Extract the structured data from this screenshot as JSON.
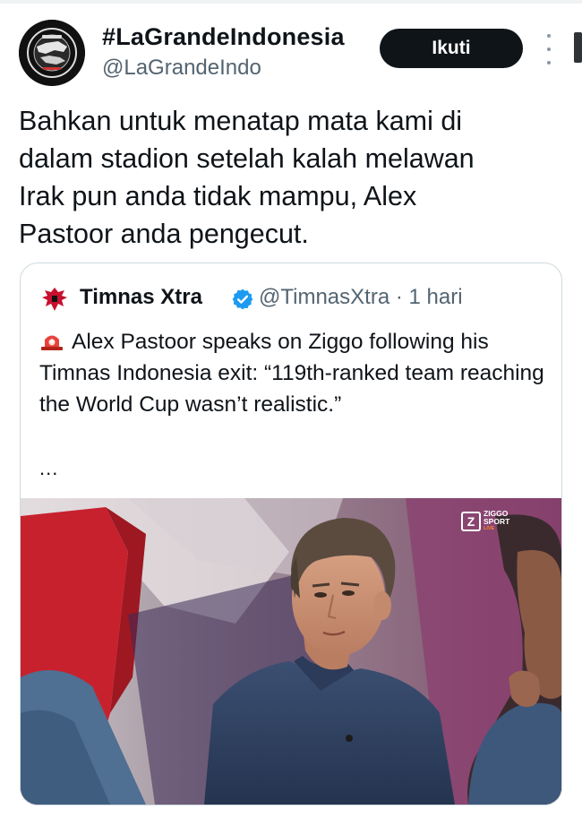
{
  "tweet": {
    "display_name": "#LaGrandeIndonesia",
    "handle": "@LaGrandeIndo",
    "follow_label": "Ikuti",
    "text": "Bahkan untuk menatap mata kami di\ndalam stadion setelah kalah melawan\nIrak pun anda tidak mampu, Alex\nPastoor anda pengecut.",
    "avatar_icon": "la-grande-logo-icon"
  },
  "quoted": {
    "display_name": "Timnas Xtra",
    "handle": "@TimnasXtra",
    "separator": "·",
    "time": "1 hari",
    "verified": true,
    "text": "Alex Pastoor speaks on Ziggo following his Timnas Indonesia exit: “119th-ranked team reaching the World Cup wasn’t realistic.”",
    "ellipsis": "...",
    "lead_icon": "siren-icon",
    "media": {
      "description_icon": "tv-studio-photo",
      "logo_line1": "ZIGGO",
      "logo_line2": "SPORT",
      "logo_line3": "LIVE"
    }
  },
  "colors": {
    "text": "#0f1419",
    "secondary": "#536471",
    "border": "#cfd9de",
    "verified": "#1d9bf0",
    "follow_bg": "#0f1419"
  }
}
